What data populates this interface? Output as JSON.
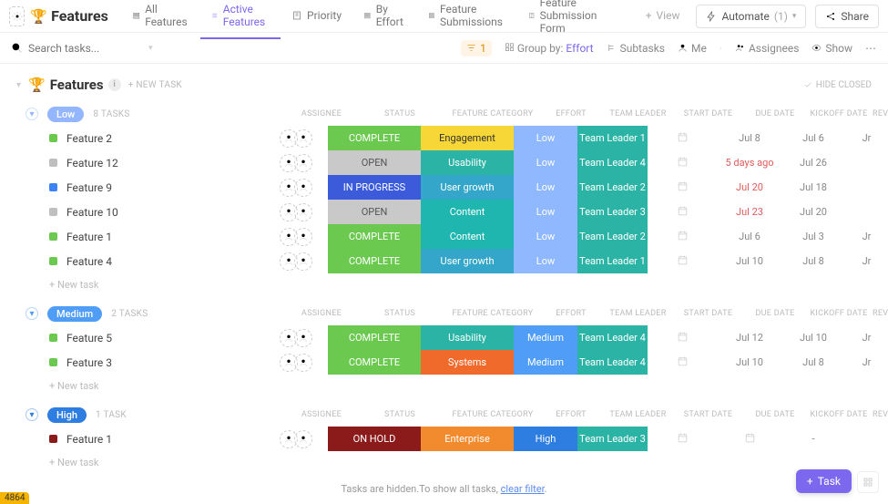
{
  "header": {
    "title": "Features",
    "views": [
      {
        "label": "All Features",
        "active": false
      },
      {
        "label": "Active Features",
        "active": true
      },
      {
        "label": "Priority",
        "active": false
      },
      {
        "label": "By Effort",
        "active": false
      },
      {
        "label": "Feature Submissions",
        "active": false
      },
      {
        "label": "Feature Submission Form",
        "active": false
      }
    ],
    "add_view": "View",
    "automate": "Automate",
    "automate_count": "(1)",
    "share": "Share"
  },
  "filterbar": {
    "search_placeholder": "Search tasks...",
    "filter_count": "1",
    "group_by_label": "Group by:",
    "group_by_value": "Effort",
    "subtasks": "Subtasks",
    "me": "Me",
    "assignees": "Assignees",
    "show": "Show"
  },
  "list_header": {
    "title": "Features",
    "new_task": "+ NEW TASK",
    "hide_closed": "HIDE CLOSED"
  },
  "columns": [
    "",
    "ASSIGNEE",
    "STATUS",
    "FEATURE CATEGORY",
    "EFFORT",
    "TEAM LEADER",
    "START DATE",
    "DUE DATE",
    "KICKOFF DATE",
    "REVI"
  ],
  "groups": [
    {
      "id": "low",
      "pill": "Low",
      "pill_class": "low",
      "count": "8 TASKS",
      "rows": [
        {
          "sq": "green",
          "name": "Feature 2",
          "status": "COMPLETE",
          "cat": "Engagement",
          "eff": "Low",
          "lead": "Team Leader 1",
          "due": "Jul 8",
          "due_red": false,
          "kick": "Jul 6",
          "rev": "Jr"
        },
        {
          "sq": "grey",
          "name": "Feature 12",
          "status": "OPEN",
          "cat": "Usability",
          "eff": "Low",
          "lead": "Team Leader 4",
          "due": "5 days ago",
          "due_red": true,
          "kick": "Jul 26",
          "rev": ""
        },
        {
          "sq": "blue",
          "name": "Feature 9",
          "status": "IN PROGRESS",
          "cat": "User growth",
          "eff": "Low",
          "lead": "Team Leader 2",
          "due": "Jul 20",
          "due_red": true,
          "kick": "Jul 18",
          "rev": ""
        },
        {
          "sq": "grey",
          "name": "Feature 10",
          "status": "OPEN",
          "cat": "Content",
          "eff": "Low",
          "lead": "Team Leader 3",
          "due": "Jul 23",
          "due_red": true,
          "kick": "Jul 20",
          "rev": ""
        },
        {
          "sq": "green",
          "name": "Feature 1",
          "status": "COMPLETE",
          "cat": "Content",
          "eff": "Low",
          "lead": "Team Leader 2",
          "due": "Jul 6",
          "due_red": false,
          "kick": "Jul 3",
          "rev": "Jr"
        },
        {
          "sq": "green",
          "name": "Feature 4",
          "status": "COMPLETE",
          "cat": "User growth",
          "eff": "Low",
          "lead": "Team Leader 1",
          "due": "Jul 10",
          "due_red": false,
          "kick": "Jul 8",
          "rev": "Jr"
        }
      ]
    },
    {
      "id": "medium",
      "pill": "Medium",
      "pill_class": "medium",
      "count": "2 TASKS",
      "rows": [
        {
          "sq": "green",
          "name": "Feature 5",
          "status": "COMPLETE",
          "cat": "Usability",
          "eff": "Medium",
          "lead": "Team Leader 4",
          "due": "Jul 12",
          "due_red": false,
          "kick": "Jul 10",
          "rev": "Jr"
        },
        {
          "sq": "green",
          "name": "Feature 3",
          "status": "COMPLETE",
          "cat": "Systems",
          "eff": "Medium",
          "lead": "Team Leader 4",
          "due": "Jul 10",
          "due_red": false,
          "kick": "Jul 8",
          "rev": "Jr"
        }
      ]
    },
    {
      "id": "high",
      "pill": "High",
      "pill_class": "high",
      "count": "1 TASK",
      "rows": [
        {
          "sq": "darkred",
          "name": "Feature 1",
          "status": "ON HOLD",
          "cat": "Enterprise",
          "eff": "High",
          "lead": "Team Leader 3",
          "due": "",
          "due_red": false,
          "kick": "-",
          "rev": ""
        }
      ]
    }
  ],
  "new_task_label": "+ New task",
  "footer": {
    "text": "Tasks are hidden.To show all tasks, ",
    "link": "clear filter",
    "end": "."
  },
  "fab": {
    "label": "Task"
  },
  "corner_badge": "4864"
}
